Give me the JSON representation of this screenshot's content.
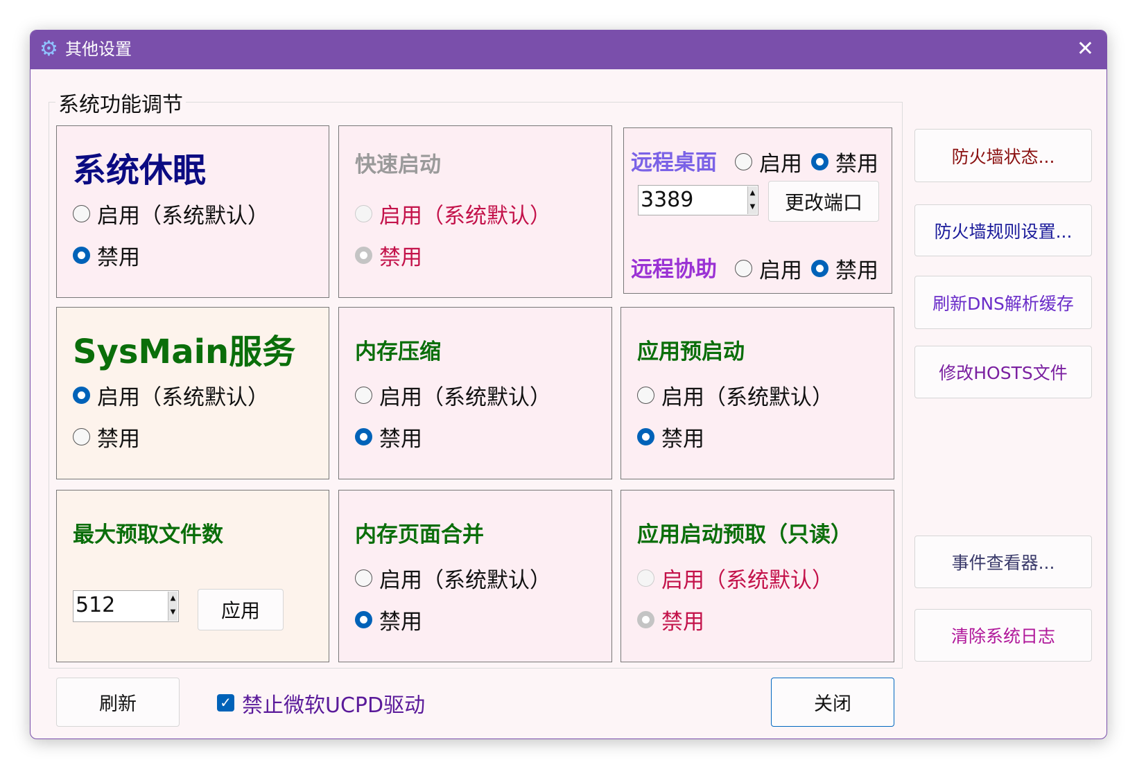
{
  "window": {
    "title": "其他设置",
    "close": "✕"
  },
  "group_label": "系统功能调节",
  "cells": {
    "sleep": {
      "title": "系统休眠",
      "opt_enable": "启用（系统默认）",
      "opt_disable": "禁用",
      "selected": "disable"
    },
    "fast_startup": {
      "title": "快速启动",
      "opt_enable": "启用（系统默认）",
      "opt_disable": "禁用",
      "selected": "disable",
      "disabled": true
    },
    "sysmain": {
      "title": "SysMain服务",
      "opt_enable": "启用（系统默认）",
      "opt_disable": "禁用",
      "selected": "enable"
    },
    "mem_compress": {
      "title": "内存压缩",
      "opt_enable": "启用（系统默认）",
      "opt_disable": "禁用",
      "selected": "disable"
    },
    "app_prelaunch": {
      "title": "应用预启动",
      "opt_enable": "启用（系统默认）",
      "opt_disable": "禁用",
      "selected": "disable"
    },
    "max_prefetch": {
      "title": "最大预取文件数",
      "value": "512",
      "apply": "应用"
    },
    "page_combine": {
      "title": "内存页面合并",
      "opt_enable": "启用（系统默认）",
      "opt_disable": "禁用",
      "selected": "disable"
    },
    "app_launch_prefetch": {
      "title": "应用启动预取（只读）",
      "opt_enable": "启用（系统默认）",
      "opt_disable": "禁用",
      "selected": "disable",
      "disabled": true
    }
  },
  "remote": {
    "desktop_label": "远程桌面",
    "assist_label": "远程协助",
    "enable": "启用",
    "disable": "禁用",
    "port": "3389",
    "change_port": "更改端口"
  },
  "side_buttons": [
    "防火墙状态...",
    "防火墙规则设置...",
    "刷新DNS解析缓存",
    "修改HOSTS文件",
    "事件查看器...",
    "清除系统日志"
  ],
  "bottom": {
    "refresh": "刷新",
    "ucpd_label": "禁止微软UCPD驱动",
    "ucpd_checked": true,
    "close": "关闭"
  }
}
